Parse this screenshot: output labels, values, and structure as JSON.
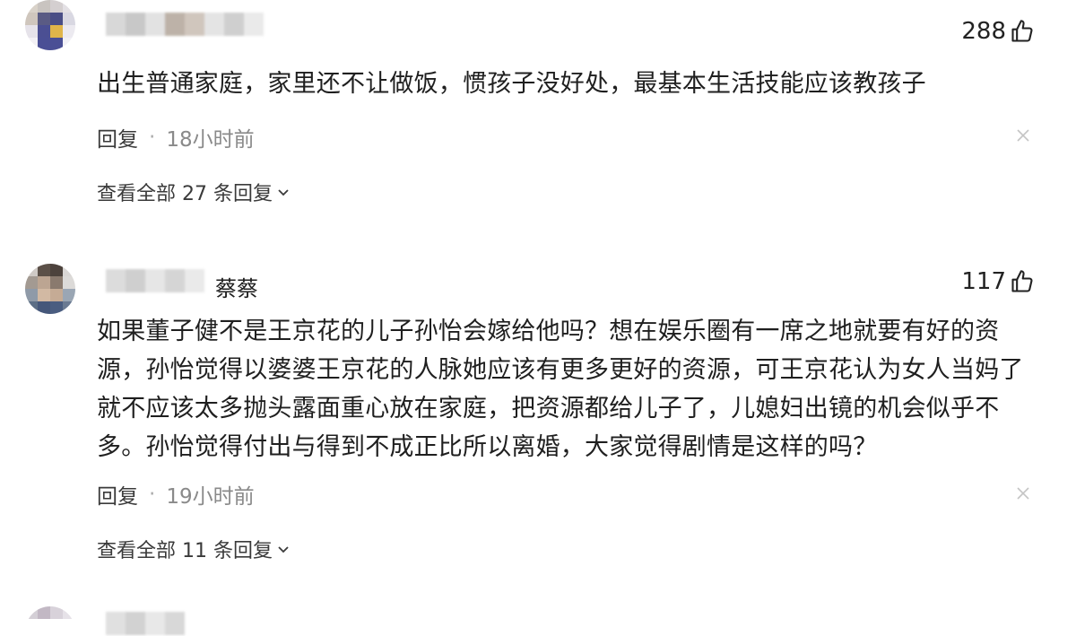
{
  "comments": [
    {
      "username": "",
      "likes": "288",
      "text": "出生普通家庭，家里还不让做饭，惯孩子没好处，最基本生活技能应该教孩子",
      "reply_label": "回复",
      "dot": "·",
      "time": "18小时前",
      "view_all": "查看全部 27 条回复"
    },
    {
      "username": "蔡蔡",
      "likes": "117",
      "text": "如果董子健不是王京花的儿子孙怡会嫁给他吗？想在娱乐圈有一席之地就要有好的资源，孙怡觉得以婆婆王京花的人脉她应该有更多更好的资源，可王京花认为女人当妈了就不应该太多抛头露面重心放在家庭，把资源都给儿子了，儿媳妇出镜的机会似乎不多。孙怡觉得付出与得到不成正比所以离婚，大家觉得剧情是这样的吗？",
      "reply_label": "回复",
      "dot": "·",
      "time": "19小时前",
      "view_all": "查看全部 11 条回复"
    }
  ],
  "icons": {
    "like": "thumbs-up-icon",
    "close": "close-icon",
    "expand": "chevron-down-icon"
  }
}
